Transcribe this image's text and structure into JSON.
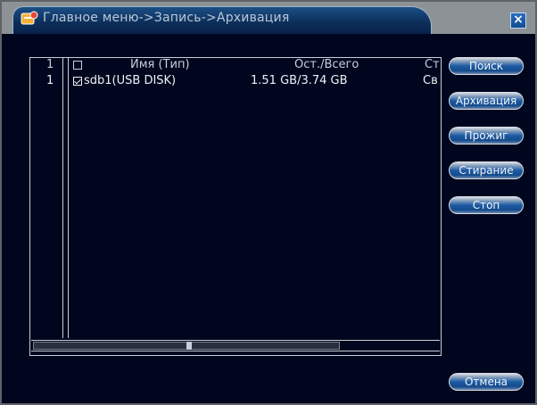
{
  "window": {
    "title": "Главное меню->Запись->Архивация",
    "close_label": "×"
  },
  "table": {
    "columns": [
      "1",
      "Имя (Тип)",
      "Ост./Всего",
      "Ст"
    ],
    "rows": [
      {
        "index": "1",
        "checked": true,
        "name": "sdb1(USB DISK)",
        "space": "1.51 GB/3.74 GB",
        "status": "Св"
      }
    ]
  },
  "scrollbar": {
    "position": 0.38
  },
  "buttons": {
    "search": "Поиск",
    "archive": "Архивация",
    "burn": "Прожиг",
    "erase": "Стирание",
    "stop": "Стоп",
    "cancel": "Отмена"
  },
  "colors": {
    "background": "#01061f",
    "title_tab": "#0c2d58",
    "button": "#1c5aa3",
    "text": "#eef1f5"
  },
  "icons": {
    "title": "menu-icon",
    "close": "close-icon"
  }
}
